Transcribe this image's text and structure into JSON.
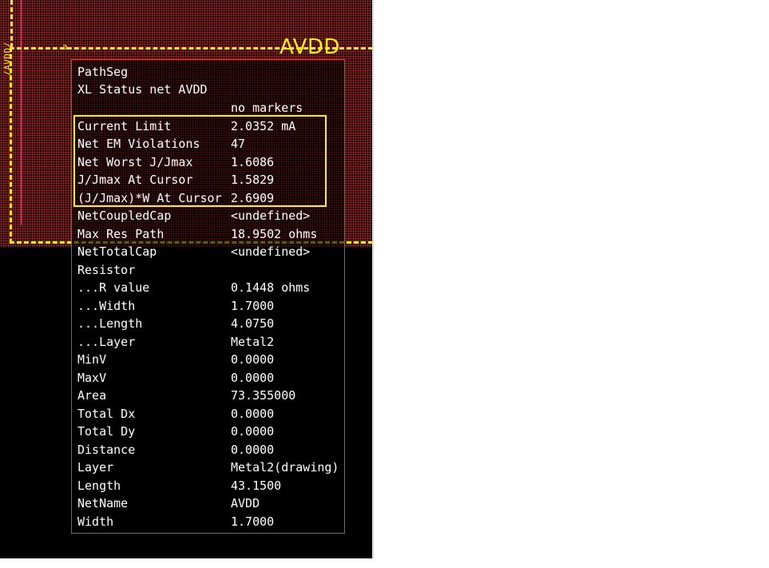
{
  "layout_view": {
    "net_label": "AVDD",
    "vertical_label": "/AVDD/",
    "marker": "a"
  },
  "info_panel": {
    "header": [
      "PathSeg",
      "XL Status net AVDD"
    ],
    "markers_note": "no markers",
    "em_properties": [
      {
        "label": "Current Limit",
        "value": "2.0352 mA"
      },
      {
        "label": "Net EM Violations",
        "value": "47"
      },
      {
        "label": "Net Worst J/Jmax",
        "value": "1.6086"
      },
      {
        "label": "J/Jmax At Cursor",
        "value": "1.5829"
      },
      {
        "label": "(J/Jmax)*W At Cursor",
        "value": "2.6909"
      }
    ],
    "properties": [
      {
        "label": "NetCoupledCap",
        "value": "<undefined>"
      },
      {
        "label": "Max Res Path",
        "value": "18.9502 ohms"
      },
      {
        "label": "NetTotalCap",
        "value": "<undefined>"
      },
      {
        "label": "Resistor",
        "value": ""
      },
      {
        "label": "...R value",
        "value": "0.1448 ohms"
      },
      {
        "label": "...Width",
        "value": "1.7000"
      },
      {
        "label": "...Length",
        "value": "4.0750"
      },
      {
        "label": "...Layer",
        "value": "Metal2"
      },
      {
        "label": "MinV",
        "value": "0.0000"
      },
      {
        "label": "MaxV",
        "value": "0.0000"
      },
      {
        "label": "Area",
        "value": "73.355000"
      },
      {
        "label": "Total Dx",
        "value": "0.0000"
      },
      {
        "label": "Total Dy",
        "value": "0.0000"
      },
      {
        "label": "Distance",
        "value": "0.0000"
      },
      {
        "label": "Layer",
        "value": "Metal2(drawing)"
      },
      {
        "label": "Length",
        "value": "43.1500"
      },
      {
        "label": "NetName",
        "value": "AVDD"
      },
      {
        "label": "Width",
        "value": "1.7000"
      }
    ]
  }
}
